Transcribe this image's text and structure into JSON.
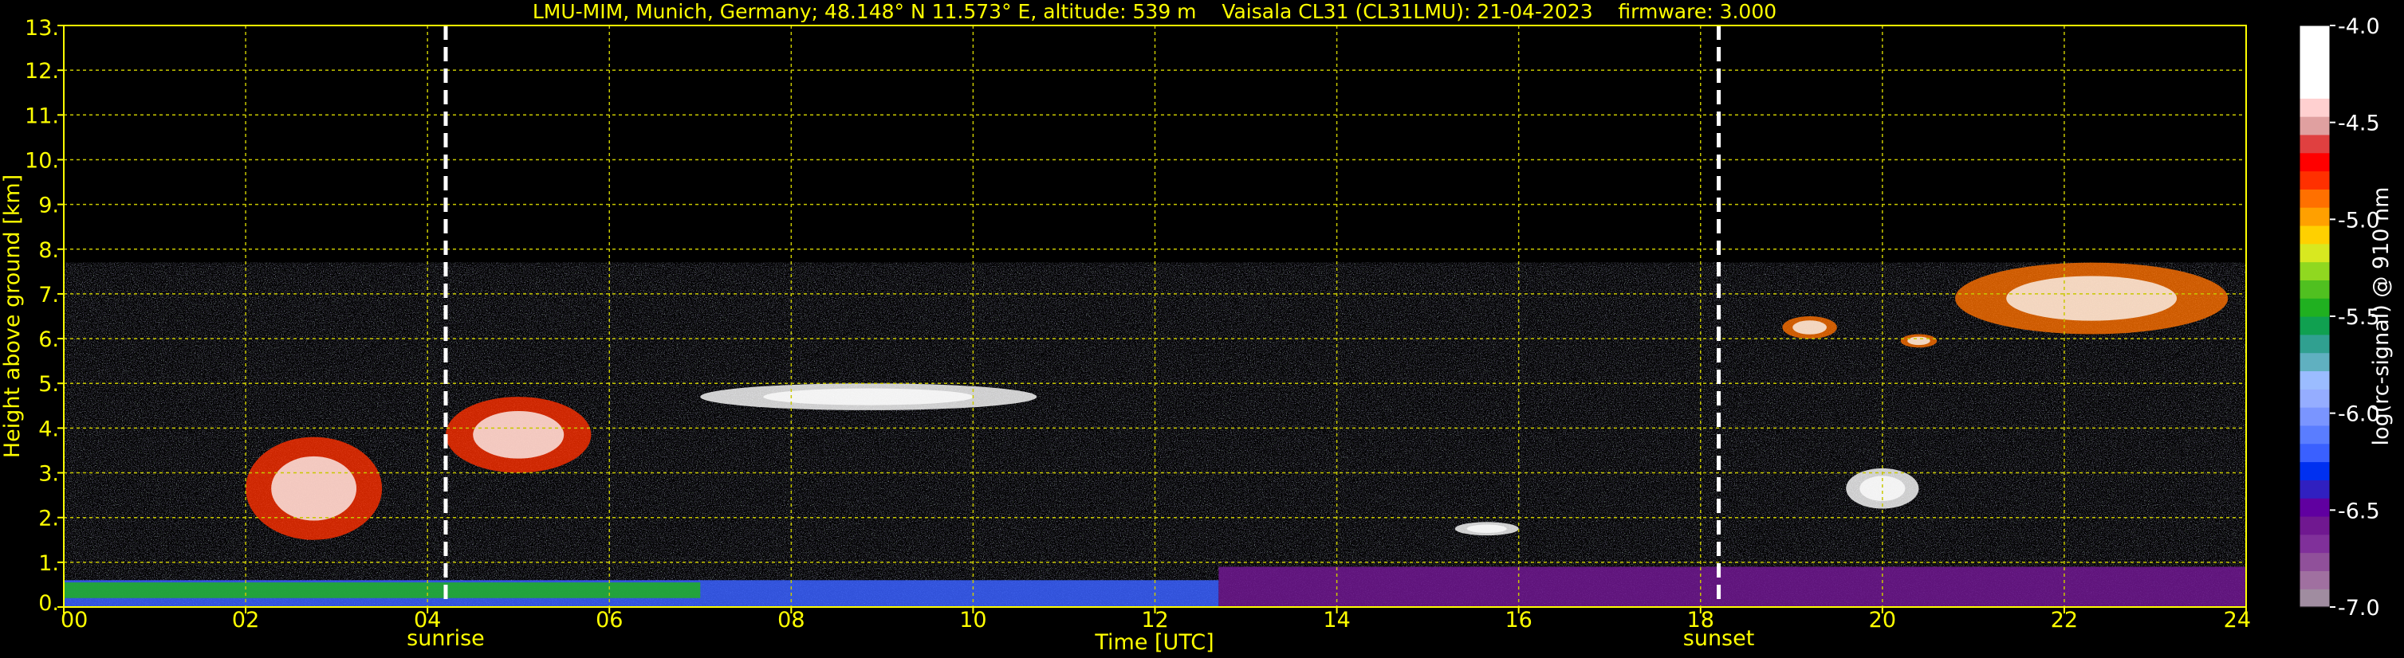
{
  "chart_data": {
    "type": "heatmap",
    "title": "LMU-MIM, Munich, Germany; 48.148° N 11.573° E, altitude: 539 m    Vaisala CL31 (CL31LMU): 21-04-2023    firmware: 3.000",
    "xlabel": "Time [UTC]",
    "ylabel": "Height above ground [km]",
    "xlim": [
      0,
      24
    ],
    "ylim": [
      0,
      13
    ],
    "x_ticks": [
      0,
      2,
      4,
      6,
      8,
      10,
      12,
      14,
      16,
      18,
      20,
      22,
      24
    ],
    "x_tick_labels": [
      "00",
      "02",
      "04",
      "06",
      "08",
      "10",
      "12",
      "14",
      "16",
      "18",
      "20",
      "22",
      "24"
    ],
    "y_ticks": [
      0,
      1,
      2,
      3,
      4,
      5,
      6,
      7,
      8,
      9,
      10,
      11,
      12,
      13
    ],
    "y_tick_labels": [
      "0.",
      "1.",
      "2.",
      "3.",
      "4.",
      "5.",
      "6.",
      "7.",
      "8.",
      "9.",
      "10.",
      "11.",
      "12.",
      "13."
    ],
    "grid": true,
    "markers": [
      {
        "label": "sunrise",
        "x": 4.2
      },
      {
        "label": "sunset",
        "x": 18.2
      }
    ],
    "data_max_height_km": 7.7,
    "colorbar": {
      "label": "log(rc-signal) @ 910 nm",
      "range": [
        -7.0,
        -4.0
      ],
      "ticks": [
        -7.0,
        -6.5,
        -6.0,
        -5.5,
        -5.0,
        -4.5,
        -4.0
      ],
      "tick_labels": [
        "-7.0",
        "-6.5",
        "-6.0",
        "-5.5",
        "-5.0",
        "-4.5",
        "-4.0"
      ],
      "colors": [
        "#a08ca0",
        "#a070a0",
        "#90509a",
        "#80309a",
        "#701890",
        "#6000a0",
        "#3020c0",
        "#0030f0",
        "#3a60ff",
        "#5a7dff",
        "#7a95ff",
        "#95adff",
        "#9bbcff",
        "#60b0c0",
        "#30a090",
        "#10a050",
        "#20b020",
        "#50c020",
        "#90d820",
        "#d8e820",
        "#ffd000",
        "#ffa000",
        "#ff7000",
        "#ff3000",
        "#ff0000",
        "#e04040",
        "#e0a0a0",
        "#ffd0d0",
        "#ffffff",
        "#ffffff",
        "#ffffff",
        "#ffffff"
      ]
    },
    "features": [
      {
        "kind": "aerosol-layer",
        "t0": 0.0,
        "t1": 12.7,
        "h0": 0.0,
        "h1": 0.6,
        "color": "#3a60ff"
      },
      {
        "kind": "aerosol-layer",
        "t0": 12.7,
        "t1": 24.0,
        "h0": 0.0,
        "h1": 0.9,
        "color": "#701890"
      },
      {
        "kind": "aerosol-layer",
        "t0": 0.0,
        "t1": 7.0,
        "h0": 0.2,
        "h1": 0.55,
        "color": "#20b020"
      },
      {
        "kind": "cloud",
        "t0": 4.2,
        "t1": 5.8,
        "h0": 3.0,
        "h1": 4.7,
        "color": "#ff3000"
      },
      {
        "kind": "cloud",
        "t0": 2.0,
        "t1": 3.5,
        "h0": 1.5,
        "h1": 3.8,
        "color": "#ff3000"
      },
      {
        "kind": "cloud",
        "t0": 7.0,
        "t1": 10.7,
        "h0": 4.4,
        "h1": 5.0,
        "color": "#ffffff"
      },
      {
        "kind": "cloud",
        "t0": 15.3,
        "t1": 16.0,
        "h0": 1.6,
        "h1": 1.9,
        "color": "#ffffff"
      },
      {
        "kind": "cloud",
        "t0": 19.6,
        "t1": 20.4,
        "h0": 2.2,
        "h1": 3.1,
        "color": "#ffffff"
      },
      {
        "kind": "cloud",
        "t0": 18.9,
        "t1": 19.5,
        "h0": 6.0,
        "h1": 6.5,
        "color": "#ff7000"
      },
      {
        "kind": "cloud",
        "t0": 20.2,
        "t1": 20.6,
        "h0": 5.8,
        "h1": 6.1,
        "color": "#ff7000"
      },
      {
        "kind": "cloud",
        "t0": 20.8,
        "t1": 23.8,
        "h0": 6.1,
        "h1": 7.7,
        "color": "#ff7000"
      }
    ]
  }
}
